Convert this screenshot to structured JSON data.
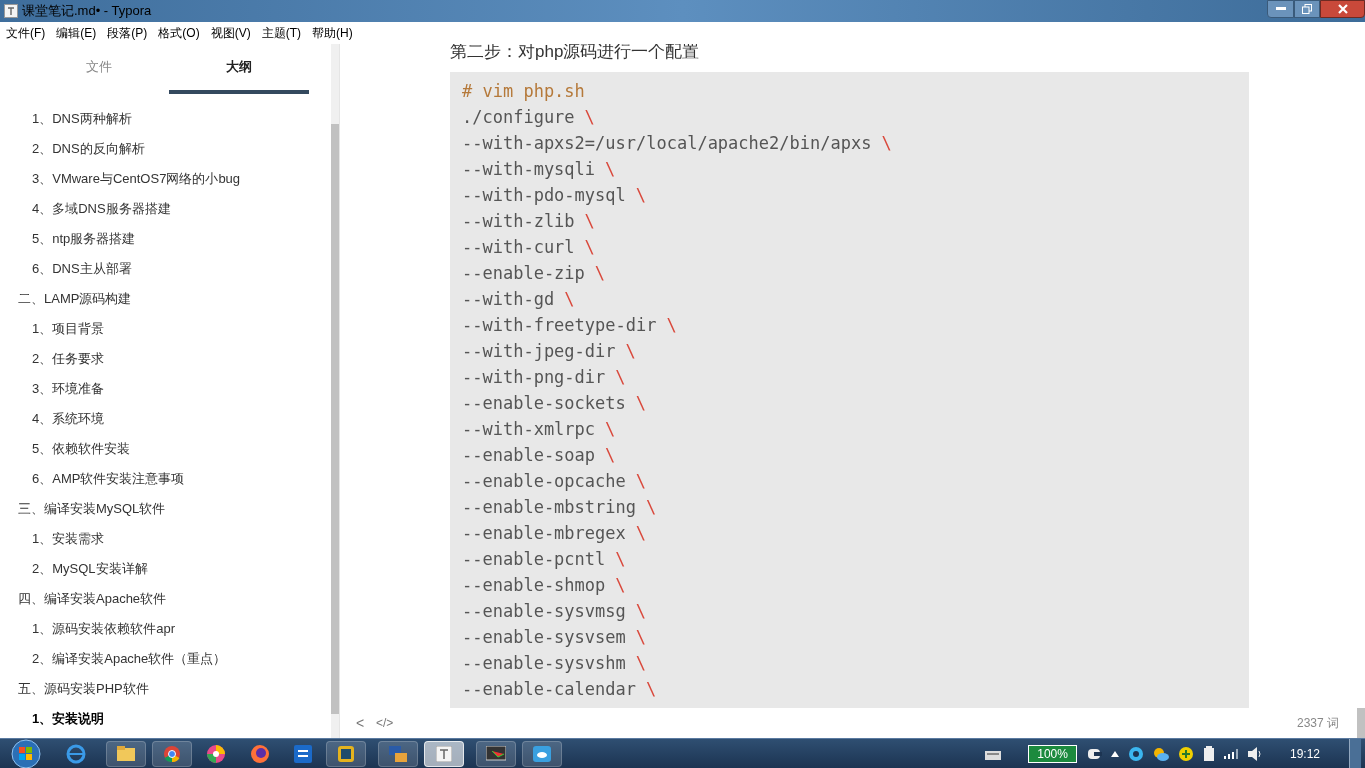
{
  "window": {
    "title": "课堂笔记.md• - Typora"
  },
  "menu": [
    "文件(F)",
    "编辑(E)",
    "段落(P)",
    "格式(O)",
    "视图(V)",
    "主题(T)",
    "帮助(H)"
  ],
  "sidebar": {
    "tabs": [
      {
        "label": "文件",
        "selected": false
      },
      {
        "label": "大纲",
        "selected": true
      }
    ],
    "outline_continued": [
      {
        "label": "1、DNS两种解析",
        "selected": false
      },
      {
        "label": "2、DNS的反向解析",
        "selected": false
      },
      {
        "label": "3、VMware与CentOS7网络的小bug",
        "selected": false
      },
      {
        "label": "4、多域DNS服务器搭建",
        "selected": false
      },
      {
        "label": "5、ntp服务器搭建",
        "selected": false
      },
      {
        "label": "6、DNS主从部署",
        "selected": false
      }
    ],
    "outline": [
      {
        "label": "二、LAMP源码构建",
        "selected": false,
        "children": [
          {
            "label": "1、项目背景",
            "selected": false
          },
          {
            "label": "2、任务要求",
            "selected": false
          },
          {
            "label": "3、环境准备",
            "selected": false
          },
          {
            "label": "4、系统环境",
            "selected": false
          },
          {
            "label": "5、依赖软件安装",
            "selected": false
          },
          {
            "label": "6、AMP软件安装注意事项",
            "selected": false
          }
        ]
      },
      {
        "label": "三、编译安装MySQL软件",
        "selected": false,
        "children": [
          {
            "label": "1、安装需求",
            "selected": false
          },
          {
            "label": "2、MySQL安装详解",
            "selected": false
          }
        ]
      },
      {
        "label": "四、编译安装Apache软件",
        "selected": false,
        "children": [
          {
            "label": "1、源码安装依赖软件apr",
            "selected": false
          },
          {
            "label": "2、编译安装Apache软件（重点）",
            "selected": false
          }
        ]
      },
      {
        "label": "五、源码安装PHP软件",
        "selected": false,
        "children": [
          {
            "label": "1、安装说明",
            "selected": true
          }
        ]
      }
    ]
  },
  "editor": {
    "heading": "第二步：对php源码进行一个配置",
    "code_lines": [
      {
        "kind": "comment",
        "text": "# vim php.sh"
      },
      {
        "kind": "code",
        "text": "./configure",
        "continuation": "\\"
      },
      {
        "kind": "code",
        "text": "--with-apxs2=/usr/local/apache2/bin/apxs",
        "continuation": "\\"
      },
      {
        "kind": "code",
        "text": "--with-mysqli",
        "continuation": "\\"
      },
      {
        "kind": "code",
        "text": "--with-pdo-mysql",
        "continuation": "\\"
      },
      {
        "kind": "code",
        "text": "--with-zlib",
        "continuation": "\\"
      },
      {
        "kind": "code",
        "text": "--with-curl",
        "continuation": "\\"
      },
      {
        "kind": "code",
        "text": "--enable-zip",
        "continuation": "\\"
      },
      {
        "kind": "code",
        "text": "--with-gd",
        "continuation": "\\"
      },
      {
        "kind": "code",
        "text": "--with-freetype-dir",
        "continuation": "\\"
      },
      {
        "kind": "code",
        "text": "--with-jpeg-dir",
        "continuation": "\\"
      },
      {
        "kind": "code",
        "text": "--with-png-dir",
        "continuation": "\\"
      },
      {
        "kind": "code",
        "text": "--enable-sockets",
        "continuation": "\\"
      },
      {
        "kind": "code",
        "text": "--with-xmlrpc",
        "continuation": "\\"
      },
      {
        "kind": "code",
        "text": "--enable-soap",
        "continuation": "\\"
      },
      {
        "kind": "code",
        "text": "--enable-opcache",
        "continuation": "\\"
      },
      {
        "kind": "code",
        "text": "--enable-mbstring",
        "continuation": "\\"
      },
      {
        "kind": "code",
        "text": "--enable-mbregex",
        "continuation": "\\"
      },
      {
        "kind": "code",
        "text": "--enable-pcntl",
        "continuation": "\\"
      },
      {
        "kind": "code",
        "text": "--enable-shmop",
        "continuation": "\\"
      },
      {
        "kind": "code",
        "text": "--enable-sysvmsg",
        "continuation": "\\"
      },
      {
        "kind": "code",
        "text": "--enable-sysvsem",
        "continuation": "\\"
      },
      {
        "kind": "code",
        "text": "--enable-sysvshm",
        "continuation": "\\"
      },
      {
        "kind": "code",
        "text": "--enable-calendar",
        "continuation": "\\"
      }
    ]
  },
  "status_bar": {
    "back": "<",
    "source": "</>",
    "word_count": "2337 词"
  },
  "taskbar": {
    "battery": "100%",
    "clock": "19:12"
  }
}
